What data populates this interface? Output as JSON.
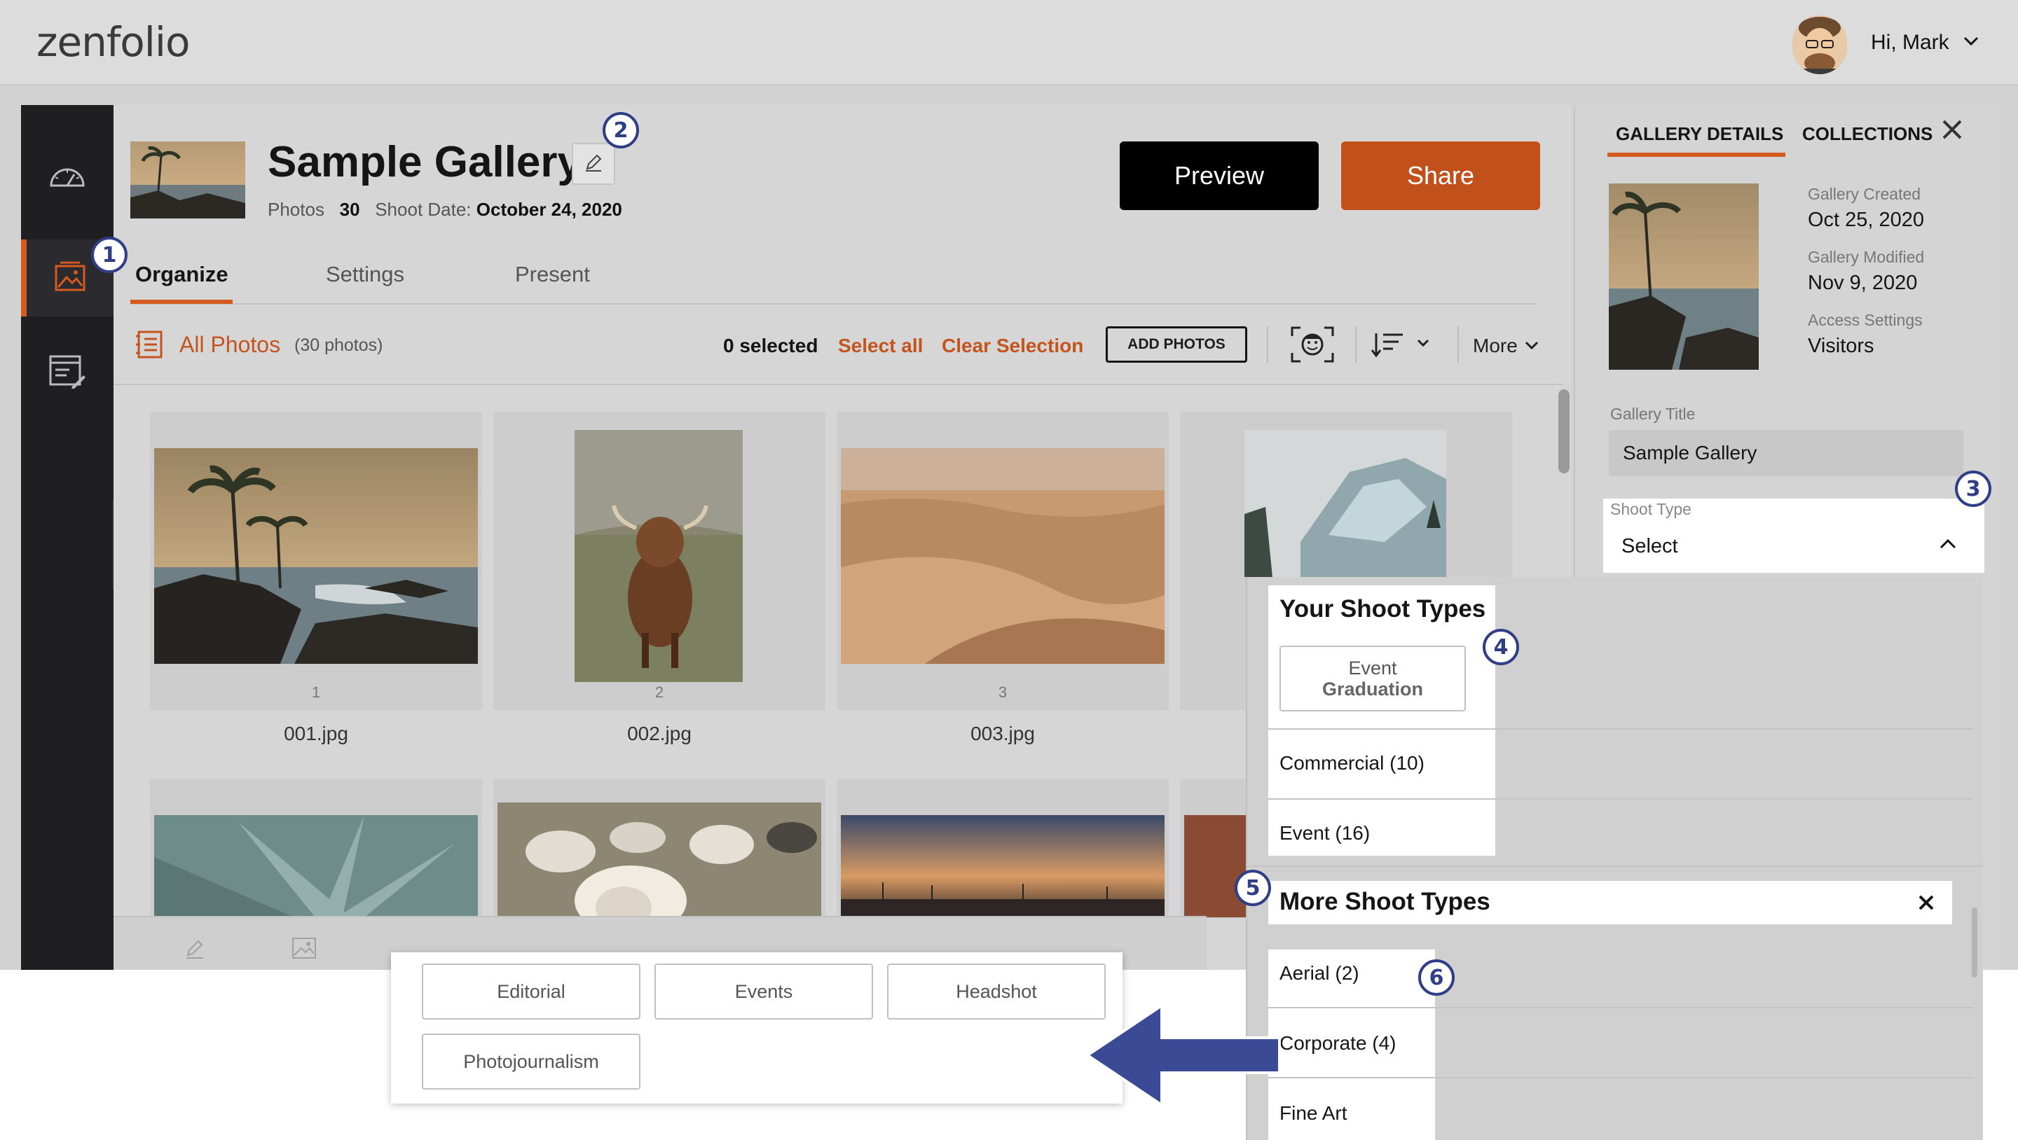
{
  "app": {
    "logo": "zenfolio",
    "greeting": "Hi, Mark"
  },
  "gallery": {
    "title": "Sample Gallery",
    "photos_label": "Photos",
    "photos_count": "30",
    "shoot_date_label": "Shoot Date:",
    "shoot_date": "October 24, 2020"
  },
  "actions": {
    "preview": "Preview",
    "share": "Share"
  },
  "tabs": [
    {
      "label": "Organize"
    },
    {
      "label": "Settings"
    },
    {
      "label": "Present"
    }
  ],
  "toolbar": {
    "all_photos": "All Photos",
    "photo_count": "(30 photos)",
    "selected": "0 selected",
    "select_all": "Select all",
    "clear_selection": "Clear Selection",
    "add_photos": "ADD PHOTOS",
    "more": "More"
  },
  "photos": [
    {
      "num": "1",
      "name": "001.jpg"
    },
    {
      "num": "2",
      "name": "002.jpg"
    },
    {
      "num": "3",
      "name": "003.jpg"
    }
  ],
  "details": {
    "tabs": [
      "GALLERY DETAILS",
      "COLLECTIONS"
    ],
    "created_label": "Gallery Created",
    "created": "Oct 25, 2020",
    "modified_label": "Gallery Modified",
    "modified": "Nov 9, 2020",
    "access_label": "Access Settings",
    "access": "Visitors",
    "title_label": "Gallery Title",
    "title_value": "Sample Gallery",
    "shoot_type_label": "Shoot Type",
    "shoot_type_value": "Select"
  },
  "dropdown": {
    "your_header": "Your Shoot Types",
    "chip_top": "Event",
    "chip_bottom": "Graduation",
    "your_items": [
      "Commercial (10)",
      "Event (16)"
    ],
    "more_header": "More Shoot Types",
    "more_items": [
      "Aerial (2)",
      "Corporate (4)",
      "Fine Art"
    ]
  },
  "subtypes": [
    "Editorial",
    "Events",
    "Headshot",
    "Photojournalism"
  ],
  "callouts": [
    "1",
    "2",
    "3",
    "4",
    "5",
    "6"
  ],
  "colors": {
    "accent": "#d45a1e",
    "callout": "#2f3e86",
    "arrow": "#3a4a94"
  },
  "icons": [
    "dashboard-icon",
    "gallery-icon",
    "website-edit-icon",
    "pencil-icon",
    "face-recognition-icon",
    "sort-icon",
    "close-icon",
    "chevron-down-icon",
    "chevron-up-icon",
    "chevron-right-icon",
    "list-icon"
  ]
}
